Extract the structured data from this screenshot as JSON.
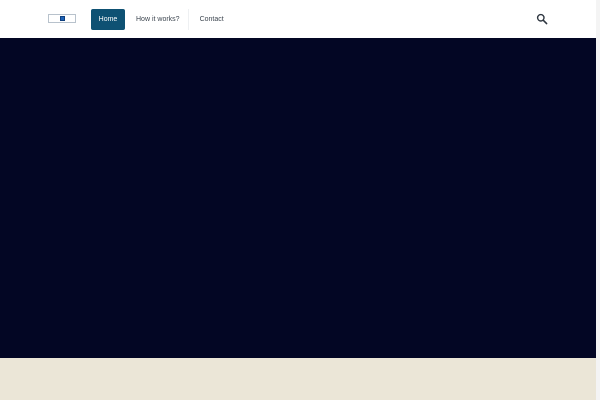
{
  "header": {
    "nav": {
      "home": "Home",
      "how_it_works": "How it works?",
      "contact": "Contact"
    },
    "search_icon": "search-icon",
    "logo_icon": "logo-icon"
  },
  "colors": {
    "nav_active_bg": "#0e5173",
    "hero_bg": "#030624",
    "band_bg": "#ebe6d7"
  }
}
